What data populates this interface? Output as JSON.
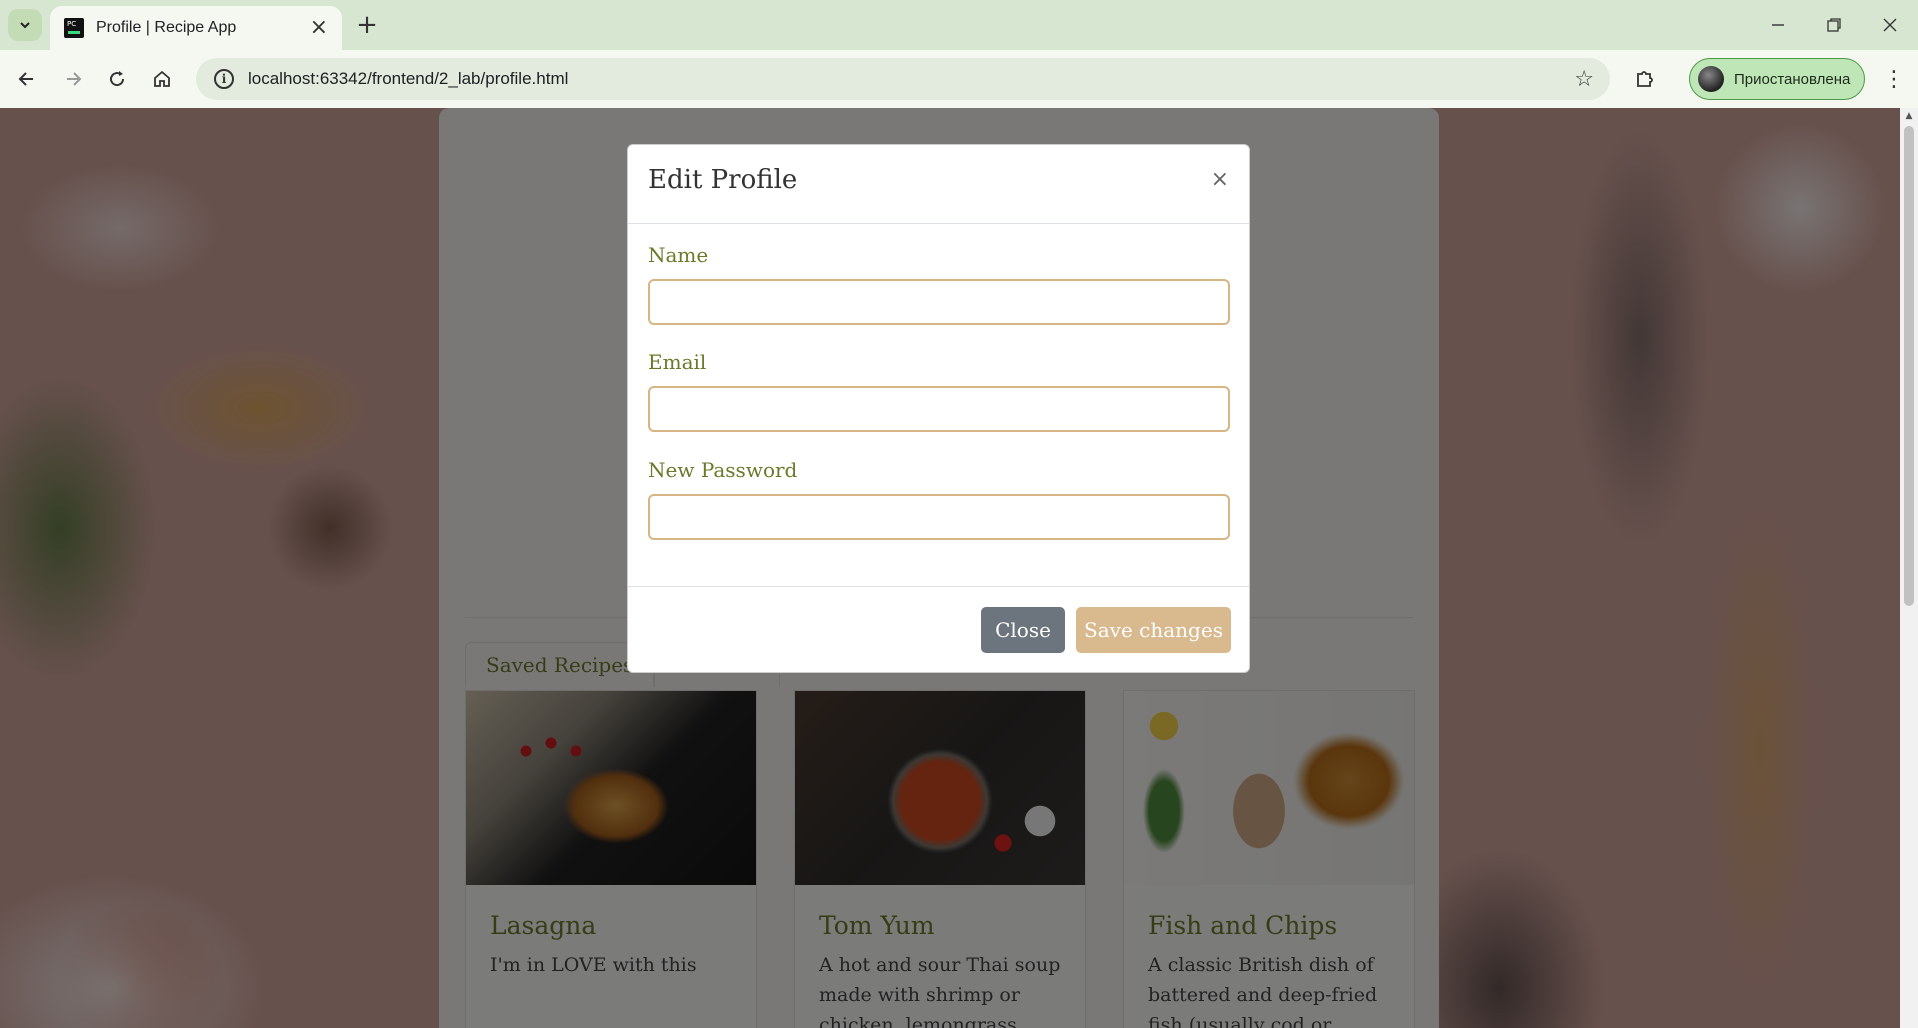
{
  "browser": {
    "tab_title": "Profile | Recipe App",
    "favicon_text": "PC",
    "url": "localhost:63342/frontend/2_lab/profile.html",
    "profile_label": "Приостановлена",
    "icons": {
      "tab_menu": "chevron-down-icon",
      "tab_close": "close-icon",
      "new_tab": "plus-icon",
      "minimize": "minimize-icon",
      "restore": "restore-icon",
      "close_window": "close-icon",
      "back": "arrow-left-icon",
      "forward": "arrow-right-icon",
      "reload": "reload-icon",
      "home": "home-icon",
      "site_info": "info-icon",
      "bookmark": "star-icon",
      "extensions": "puzzle-icon",
      "menu": "kebab-icon"
    }
  },
  "page": {
    "tabs": [
      {
        "label": "Saved Recipes"
      },
      {
        "label": ""
      }
    ],
    "recipes": [
      {
        "title": "Lasagna",
        "description": "I'm in LOVE with this"
      },
      {
        "title": "Tom Yum",
        "description": "A hot and sour Thai soup made with shrimp or chicken, lemongrass, lime"
      },
      {
        "title": "Fish and Chips",
        "description": "A classic British dish of battered and deep-fried fish (usually cod or"
      }
    ]
  },
  "modal": {
    "title": "Edit Profile",
    "close_symbol": "×",
    "fields": {
      "name": {
        "label": "Name",
        "value": ""
      },
      "email": {
        "label": "Email",
        "value": ""
      },
      "password": {
        "label": "New Password",
        "value": ""
      }
    },
    "close_button": "Close",
    "save_button": "Save changes"
  },
  "colors": {
    "accent_olive": "#6b7a2a",
    "input_border": "#d8b584",
    "save_button": "#d9b98e",
    "close_button": "#6c757d",
    "profile_pill": "#bfe6b6"
  }
}
